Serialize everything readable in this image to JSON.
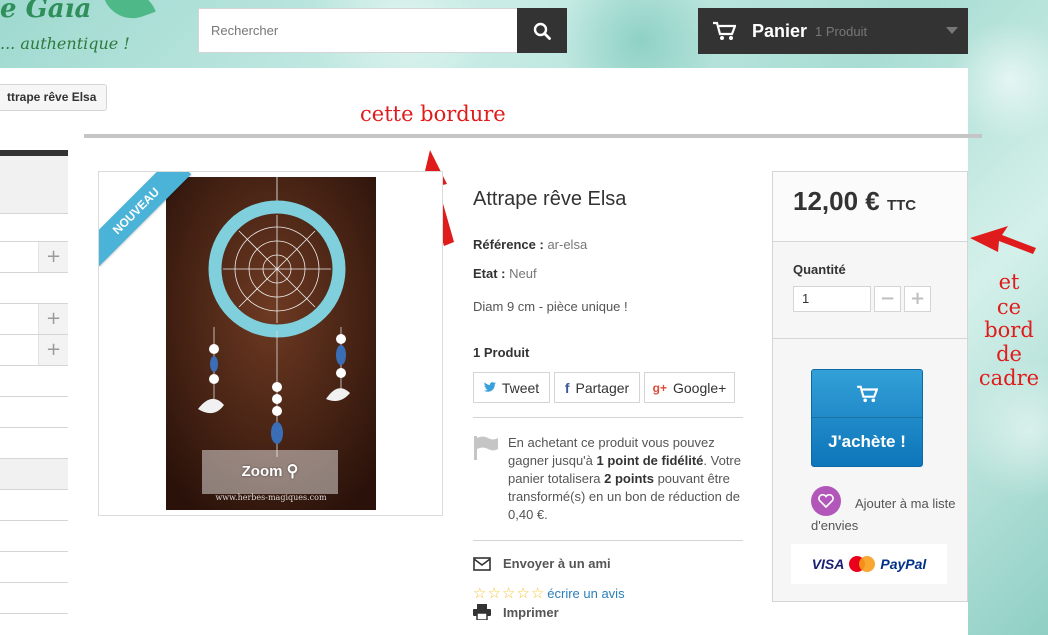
{
  "header": {
    "logo_text": "e Gaïa",
    "tagline": "... authentique !",
    "search_placeholder": "Rechercher",
    "cart_label": "Panier",
    "cart_count": "1 Produit"
  },
  "breadcrumb": {
    "current": "ttrape rêve Elsa"
  },
  "annotations": {
    "top": "cette bordure",
    "right": [
      "et",
      "ce",
      "bord",
      "de",
      "cadre"
    ]
  },
  "product": {
    "badge": "NOUVEAU",
    "zoom_label": "Zoom",
    "photo_caption": "www.herbes-magiques.com",
    "title": "Attrape rêve Elsa",
    "reference_label": "Référence :",
    "reference_value": "ar-elsa",
    "condition_label": "Etat :",
    "condition_value": "Neuf",
    "description": "Diam 9 cm - pièce unique !",
    "stock": "1 Produit",
    "share_buttons": [
      "Tweet",
      "Partager",
      "Google+"
    ],
    "loyalty": {
      "text1": "En achetant ce produit vous pouvez gagner jusqu'à ",
      "points": "1 point de fidélité",
      "text2": ". Votre panier totalisera ",
      "total_points": "2 points",
      "text3": " pouvant être transformé(s) en un bon de réduction de 0,40 €."
    },
    "send_friend": "Envoyer à un ami",
    "review_link": "écrire un avis",
    "print": "Imprimer"
  },
  "buy_box": {
    "price": "12,00 €",
    "tax_label": "TTC",
    "quantity_label": "Quantité",
    "quantity_value": "1",
    "minus": "−",
    "plus": "+",
    "buy_label": "J'achète !",
    "wishlist_text": "Ajouter à ma liste d'envies",
    "payment_visa": "VISA",
    "payment_paypal": "PayPal"
  },
  "colors": {
    "dark": "#333333",
    "accent_blue": "#2a7fbb",
    "ribbon": "#4bb3d8",
    "annotation_red": "#e01b1b",
    "wishlist_purple": "#b257b9"
  }
}
